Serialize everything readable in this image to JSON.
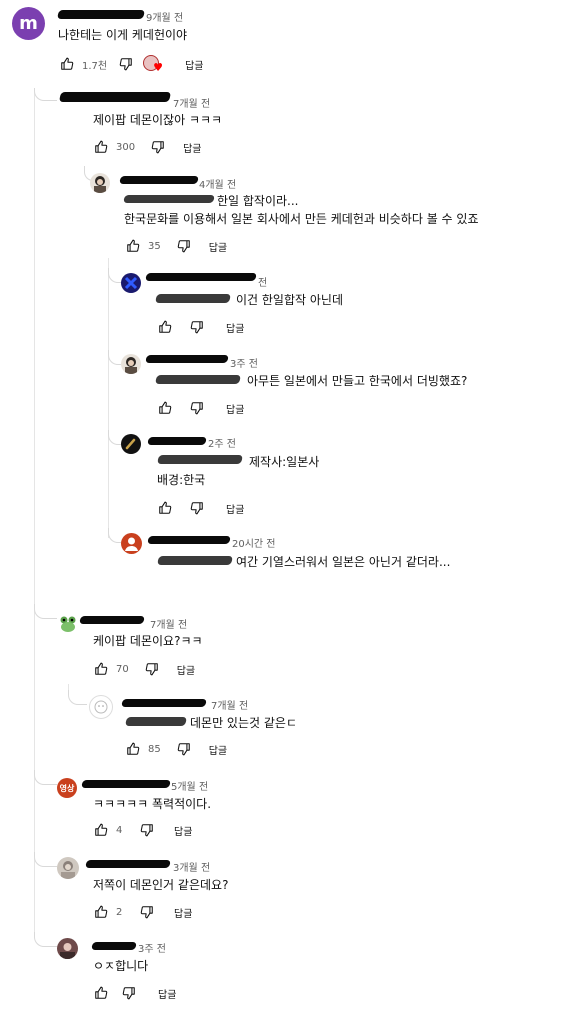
{
  "comments": [
    {
      "time": "9개월 전",
      "text": "나한테는 이게 케데헌이야",
      "likes": "1.7천",
      "reply": "답글"
    },
    {
      "time": "7개월 전",
      "text": "제이팝 데몬이잖아 ㅋㅋㅋ",
      "likes": "300",
      "reply": "답글"
    },
    {
      "time": "4개월 전",
      "text_line1": "한일 합작이라...",
      "text_line2": "한국문화를 이용해서 일본 회사에서 만든 케데헌과 비슷하다 볼 수 있죠",
      "likes": "35",
      "reply": "답글"
    },
    {
      "time": "전",
      "text": "이건 한일합작 아닌데",
      "reply": "답글"
    },
    {
      "time": "3주 전",
      "text": "아무튼 일본에서 만들고 한국에서 더빙했죠?",
      "reply": "답글"
    },
    {
      "time": "2주 전",
      "text_line1": "제작사:일본사",
      "text_line2": "배경:한국",
      "reply": "답글"
    },
    {
      "time": "20시간 전",
      "text": "여간 기열스러워서 일본은 아닌거 같더라...",
      "reply": "답글"
    },
    {
      "time": "7개월 전",
      "text": "케이팝 데몬이요?ㅋㅋ",
      "likes": "70",
      "reply": "답글"
    },
    {
      "time": "7개월 전",
      "text": "데몬만 있는것 같은ㄷ",
      "likes": "85",
      "reply": "답글"
    },
    {
      "time": "5개월 전",
      "avatar_label": "영상",
      "text": "ㅋㅋㅋㅋㅋ 폭력적이다.",
      "likes": "4",
      "reply": "답글"
    },
    {
      "time": "3개월 전",
      "text": "저쪽이 데몬인거 같은데요?",
      "likes": "2",
      "reply": "답글"
    },
    {
      "time": "3주 전",
      "text": "ㅇㅈ합니다",
      "reply": "답글"
    }
  ],
  "first_avatar_letter": "m",
  "colors": {
    "accent": "#065fd4",
    "heart": "#ff0000",
    "avatar_m": "#7b3fb0",
    "avatar_orange": "#c9401e"
  }
}
